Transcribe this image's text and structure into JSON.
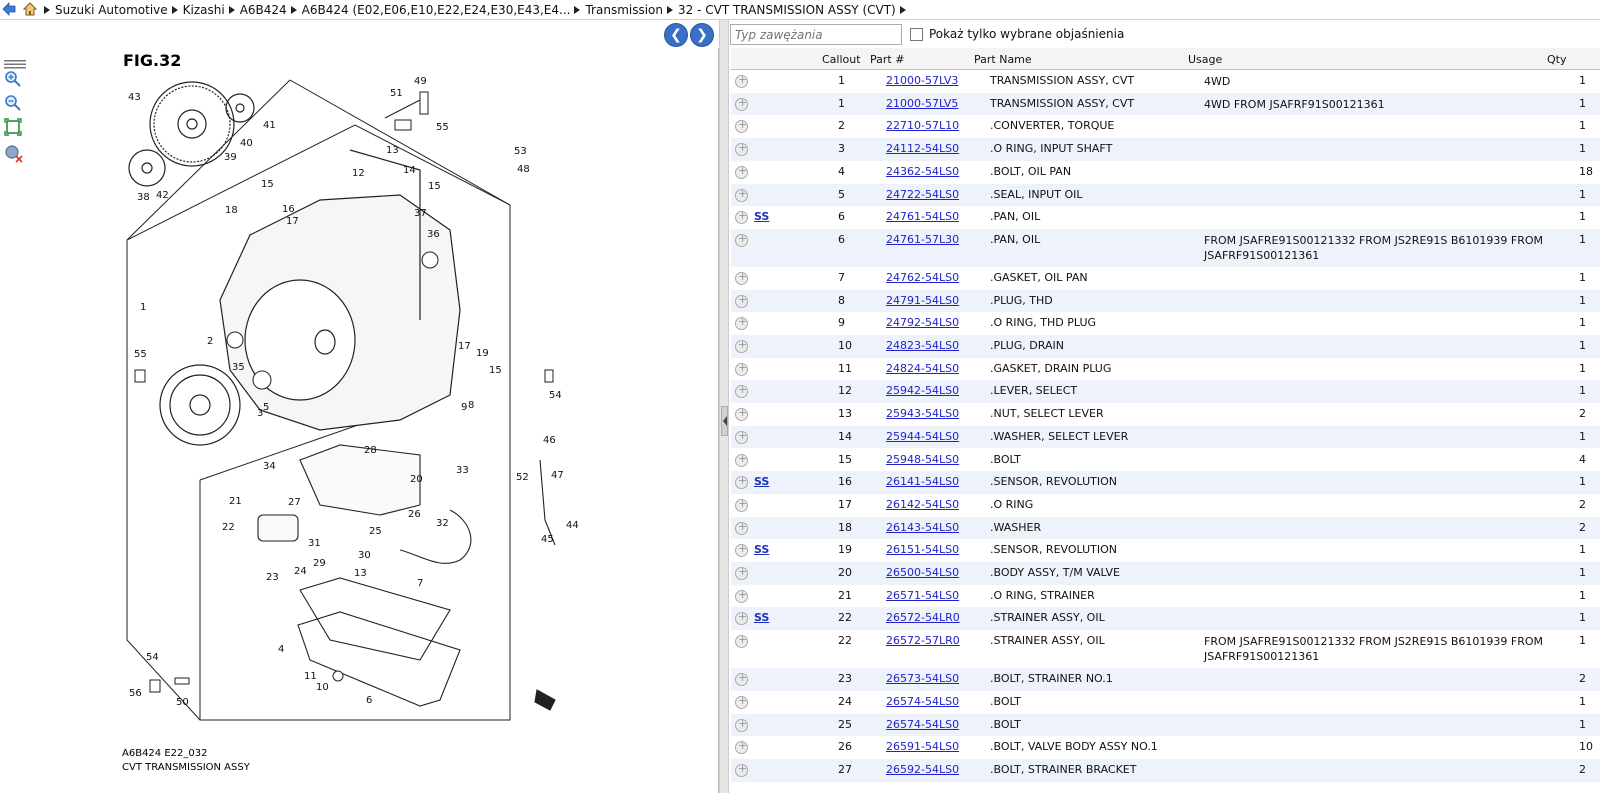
{
  "breadcrumb": [
    {
      "label": "Suzuki Automotive"
    },
    {
      "label": "Kizashi"
    },
    {
      "label": "A6B424"
    },
    {
      "label": "A6B424 (E02,E06,E10,E22,E24,E30,E43,E4..."
    },
    {
      "label": "Transmission"
    },
    {
      "label": "32 - CVT TRANSMISSION ASSY (CVT)"
    }
  ],
  "filter": {
    "placeholder": "Typ zawężania",
    "checkbox_label": "Pokaż tylko wybrane objaśnienia"
  },
  "figure": {
    "title": "FIG.32",
    "code": "A6B424 E22_032",
    "name": "CVT TRANSMISSION ASSY",
    "callouts": [
      "43",
      "49",
      "51",
      "55",
      "41",
      "40",
      "39",
      "38",
      "42",
      "53",
      "48",
      "13",
      "12",
      "14",
      "15",
      "37",
      "15",
      "16",
      "18",
      "17",
      "36",
      "1",
      "55",
      "2",
      "35",
      "3",
      "5",
      "17",
      "19",
      "9",
      "15",
      "8",
      "54",
      "28",
      "46",
      "47",
      "52",
      "44",
      "45",
      "20",
      "34",
      "27",
      "21",
      "26",
      "33",
      "22",
      "25",
      "32",
      "31",
      "30",
      "29",
      "13",
      "23",
      "24",
      "7",
      "4",
      "54",
      "11",
      "10",
      "56",
      "50",
      "6"
    ]
  },
  "table": {
    "headers": {
      "callout": "Callout",
      "part": "Part #",
      "name": "Part Name",
      "usage": "Usage",
      "qty": "Qty"
    },
    "rows": [
      {
        "ss": "",
        "callout": "1",
        "part": "21000-57LV3",
        "name": "TRANSMISSION ASSY, CVT",
        "usage": "4WD",
        "qty": "1"
      },
      {
        "ss": "",
        "callout": "1",
        "part": "21000-57LV5",
        "name": "TRANSMISSION ASSY, CVT",
        "usage": "4WD FROM JSAFRF91S00121361",
        "qty": "1"
      },
      {
        "ss": "",
        "callout": "2",
        "part": "22710-57L10",
        "name": ".CONVERTER, TORQUE",
        "usage": "",
        "qty": "1"
      },
      {
        "ss": "",
        "callout": "3",
        "part": "24112-54LS0",
        "name": ".O RING, INPUT SHAFT",
        "usage": "",
        "qty": "1"
      },
      {
        "ss": "",
        "callout": "4",
        "part": "24362-54LS0",
        "name": ".BOLT, OIL PAN",
        "usage": "",
        "qty": "18"
      },
      {
        "ss": "",
        "callout": "5",
        "part": "24722-54LS0",
        "name": ".SEAL, INPUT OIL",
        "usage": "",
        "qty": "1"
      },
      {
        "ss": "SS",
        "callout": "6",
        "part": "24761-54LS0",
        "name": ".PAN, OIL",
        "usage": "",
        "qty": "1"
      },
      {
        "ss": "",
        "callout": "6",
        "part": "24761-57L30",
        "name": ".PAN, OIL",
        "usage": "FROM JSAFRE91S00121332 FROM JS2RE91S B6101939 FROM JSAFRF91S00121361",
        "qty": "1"
      },
      {
        "ss": "",
        "callout": "7",
        "part": "24762-54LS0",
        "name": ".GASKET, OIL PAN",
        "usage": "",
        "qty": "1"
      },
      {
        "ss": "",
        "callout": "8",
        "part": "24791-54LS0",
        "name": ".PLUG, THD",
        "usage": "",
        "qty": "1"
      },
      {
        "ss": "",
        "callout": "9",
        "part": "24792-54LS0",
        "name": ".O RING, THD PLUG",
        "usage": "",
        "qty": "1"
      },
      {
        "ss": "",
        "callout": "10",
        "part": "24823-54LS0",
        "name": ".PLUG, DRAIN",
        "usage": "",
        "qty": "1"
      },
      {
        "ss": "",
        "callout": "11",
        "part": "24824-54LS0",
        "name": ".GASKET, DRAIN PLUG",
        "usage": "",
        "qty": "1"
      },
      {
        "ss": "",
        "callout": "12",
        "part": "25942-54LS0",
        "name": ".LEVER, SELECT",
        "usage": "",
        "qty": "1"
      },
      {
        "ss": "",
        "callout": "13",
        "part": "25943-54LS0",
        "name": ".NUT, SELECT LEVER",
        "usage": "",
        "qty": "2"
      },
      {
        "ss": "",
        "callout": "14",
        "part": "25944-54LS0",
        "name": ".WASHER, SELECT LEVER",
        "usage": "",
        "qty": "1"
      },
      {
        "ss": "",
        "callout": "15",
        "part": "25948-54LS0",
        "name": ".BOLT",
        "usage": "",
        "qty": "4"
      },
      {
        "ss": "SS",
        "callout": "16",
        "part": "26141-54LS0",
        "name": ".SENSOR, REVOLUTION",
        "usage": "",
        "qty": "1"
      },
      {
        "ss": "",
        "callout": "17",
        "part": "26142-54LS0",
        "name": ".O RING",
        "usage": "",
        "qty": "2"
      },
      {
        "ss": "",
        "callout": "18",
        "part": "26143-54LS0",
        "name": ".WASHER",
        "usage": "",
        "qty": "2"
      },
      {
        "ss": "SS",
        "callout": "19",
        "part": "26151-54LS0",
        "name": ".SENSOR, REVOLUTION",
        "usage": "",
        "qty": "1"
      },
      {
        "ss": "",
        "callout": "20",
        "part": "26500-54LS0",
        "name": ".BODY ASSY, T/M VALVE",
        "usage": "",
        "qty": "1"
      },
      {
        "ss": "",
        "callout": "21",
        "part": "26571-54LS0",
        "name": ".O RING, STRAINER",
        "usage": "",
        "qty": "1"
      },
      {
        "ss": "SS",
        "callout": "22",
        "part": "26572-54LR0",
        "name": ".STRAINER ASSY, OIL",
        "usage": "",
        "qty": "1"
      },
      {
        "ss": "",
        "callout": "22",
        "part": "26572-57LR0",
        "name": ".STRAINER ASSY, OIL",
        "usage": "FROM JSAFRE91S00121332 FROM JS2RE91S B6101939 FROM JSAFRF91S00121361",
        "qty": "1"
      },
      {
        "ss": "",
        "callout": "23",
        "part": "26573-54LS0",
        "name": ".BOLT, STRAINER NO.1",
        "usage": "",
        "qty": "2"
      },
      {
        "ss": "",
        "callout": "24",
        "part": "26574-54LS0",
        "name": ".BOLT",
        "usage": "",
        "qty": "1"
      },
      {
        "ss": "",
        "callout": "25",
        "part": "26574-54LS0",
        "name": ".BOLT",
        "usage": "",
        "qty": "1"
      },
      {
        "ss": "",
        "callout": "26",
        "part": "26591-54LS0",
        "name": ".BOLT, VALVE BODY ASSY NO.1",
        "usage": "",
        "qty": "10"
      },
      {
        "ss": "",
        "callout": "27",
        "part": "26592-54LS0",
        "name": ".BOLT, STRAINER BRACKET",
        "usage": "",
        "qty": "2"
      }
    ]
  }
}
